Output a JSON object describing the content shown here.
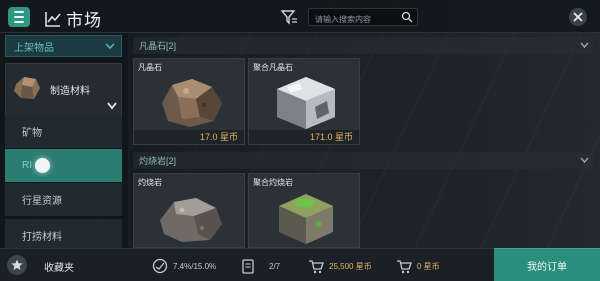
{
  "header": {
    "title": "市场",
    "search_placeholder": "请输入搜索内容"
  },
  "sidebar": {
    "dropdown_label": "上架物品",
    "category": "制造材料",
    "items": [
      {
        "label": "矿物"
      },
      {
        "label": "RI",
        "active": true
      },
      {
        "label": "行星资源"
      },
      {
        "label": "打捞材料"
      }
    ],
    "favorites_label": "收藏夹"
  },
  "sections": [
    {
      "title": "凡晶石[2]",
      "items": [
        {
          "name": "凡晶石",
          "price": "17.0 星币",
          "icon": "ore-brown-icon"
        },
        {
          "name": "聚合凡晶石",
          "price": "171.0 星币",
          "icon": "ore-silver-icon"
        }
      ]
    },
    {
      "title": "灼烧岩[2]",
      "items": [
        {
          "name": "灼烧岩",
          "icon": "ore-gray-icon"
        },
        {
          "name": "聚合灼烧岩",
          "icon": "ore-green-icon"
        }
      ]
    }
  ],
  "status": {
    "cargo": "7.4%/15.0%",
    "orders": "2/7",
    "funds": "25,500 星币",
    "escrow": "0 星币"
  },
  "buttons": {
    "my_orders": "我的订单"
  },
  "colors": {
    "accent": "#2a8e7c",
    "price": "#e2b564",
    "menu": "#2f9784"
  }
}
